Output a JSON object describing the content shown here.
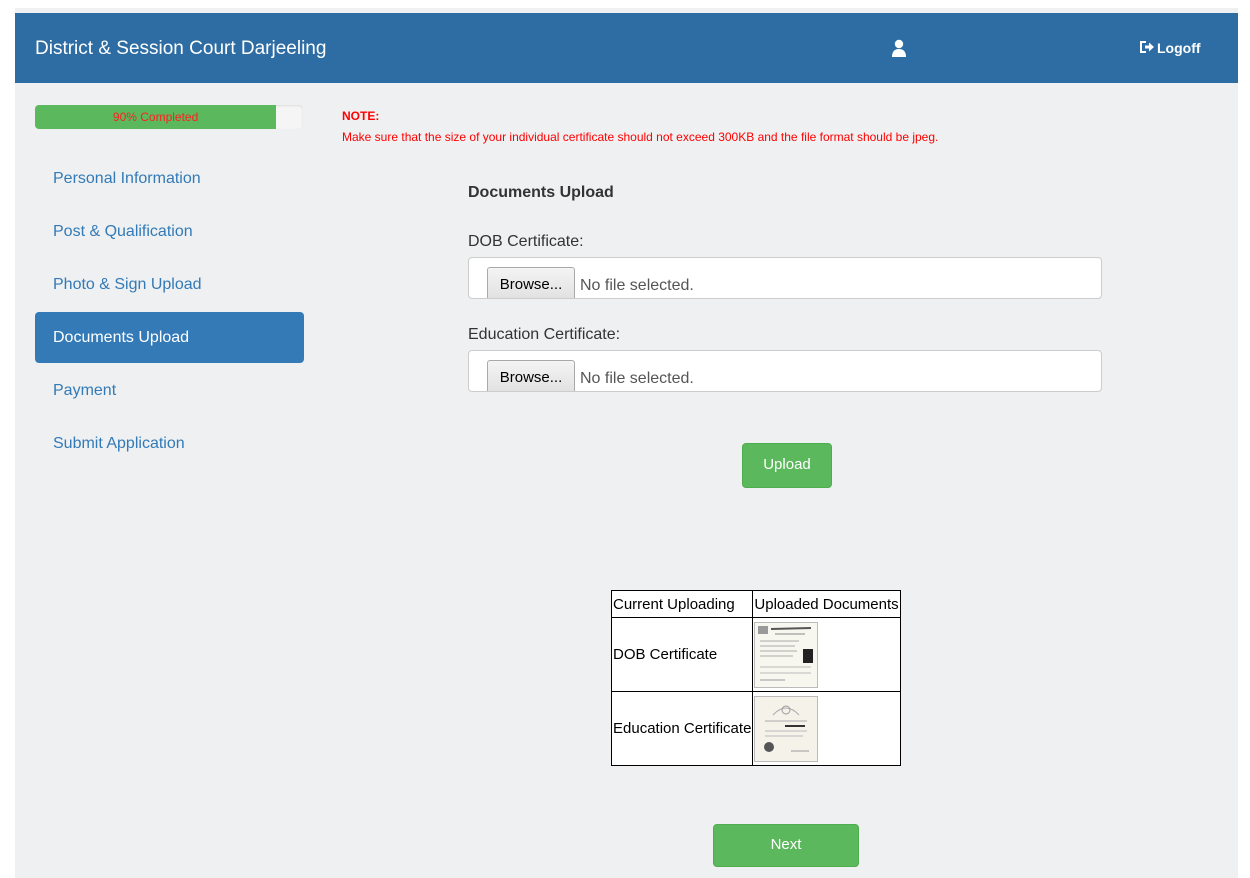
{
  "header": {
    "title": "District & Session Court Darjeeling",
    "user_name": "",
    "logoff_label": "Logoff",
    "user_icon": "user-icon",
    "logoff_icon": "logoff-icon"
  },
  "progress": {
    "label": "90% Completed",
    "percent": 90
  },
  "sidebar": {
    "items": [
      {
        "label": "Personal Information",
        "active": false
      },
      {
        "label": "Post & Qualification",
        "active": false
      },
      {
        "label": "Photo & Sign Upload",
        "active": false
      },
      {
        "label": "Documents Upload",
        "active": true
      },
      {
        "label": "Payment",
        "active": false
      },
      {
        "label": "Submit Application",
        "active": false
      }
    ]
  },
  "note": {
    "title": "NOTE:",
    "text": "Make sure that the size of your individual certificate should not exceed 300KB and the file format should be jpeg."
  },
  "form": {
    "title": "Documents Upload",
    "fields": [
      {
        "label": "DOB Certificate:",
        "browse_label": "Browse...",
        "status": "No file selected."
      },
      {
        "label": "Education Certificate:",
        "browse_label": "Browse...",
        "status": "No file selected."
      }
    ],
    "upload_label": "Upload"
  },
  "table": {
    "headers": [
      "Current Uploading",
      "Uploaded Documents"
    ],
    "rows": [
      {
        "name": "DOB Certificate"
      },
      {
        "name": "Education Certificate"
      }
    ]
  },
  "next_label": "Next",
  "colors": {
    "header_bg": "#2e6da4",
    "active_nav": "#337ab7",
    "success": "#5cb85c",
    "note": "#ff0000"
  }
}
